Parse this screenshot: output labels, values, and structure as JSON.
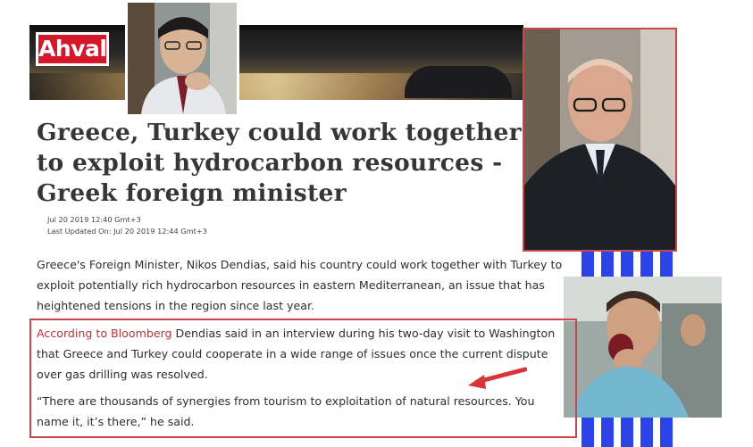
{
  "site": {
    "logo_text": "Ahval"
  },
  "article": {
    "headline": "Greece, Turkey could work together to exploit hydrocarbon resources - Greek foreign minister",
    "published": "Jul 20 2019 12:40 Gmt+3",
    "updated_label": "Last Updated On:",
    "updated": "Jul 20 2019 12:44 Gmt+3",
    "paragraph_1": "Greece's Foreign Minister, Nikos Dendias, said his country could work together with Turkey to exploit potentially rich hydrocarbon resources in eastern Mediterranean, an issue that has heightened tensions in the region since last year.",
    "source_link": "According to Bloomberg",
    "paragraph_2_rest": " Dendias said in an interview during his two-day visit to Washington that Greece and Turkey could cooperate in a wide range of issues once the current dispute over gas drilling was resolved.",
    "quote": "“There are thousands of synergies from tourism to exploitation of natural resources. You name it, it’s there,” he said."
  },
  "colors": {
    "logo_red": "#d3182a",
    "highlight_border": "#c9474c",
    "arrow": "#d8343a",
    "link": "#b5343a",
    "stripe_blue": "#2c43e8"
  }
}
